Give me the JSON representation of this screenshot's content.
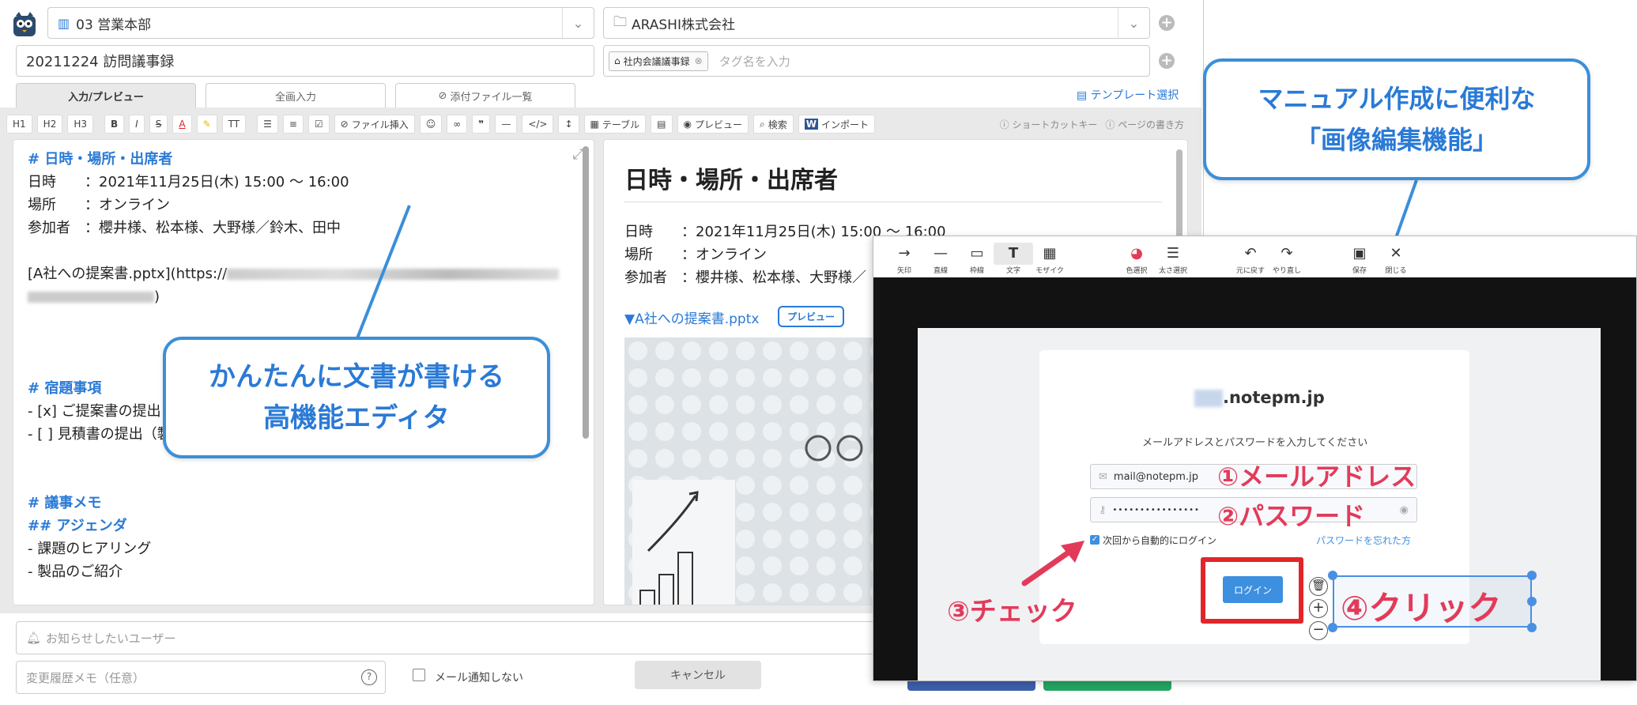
{
  "header": {
    "department": "03 営業本部",
    "folder": "ARASHI株式会社",
    "title": "20211224 訪問議事録",
    "tag": "社内会議議事録",
    "tag_placeholder": "タグ名を入力",
    "template_link": "テンプレート選択"
  },
  "tabs": [
    "入力/プレビュー",
    "全画入力",
    "添付ファイル一覧"
  ],
  "toolbar": {
    "h1": "H1",
    "h2": "H2",
    "h3": "H3",
    "bold": "B",
    "italic": "I",
    "strike": "S",
    "color": "A",
    "size": "TT",
    "attach": "ファイル挿入",
    "table": "テーブル",
    "preview": "プレビュー",
    "search": "検索",
    "import": "インポート",
    "shortcut": "ショートカットキー",
    "howto": "ページの書き方"
  },
  "editor": {
    "h_meeting": "# 日時・場所・出席者",
    "date_line": "日時　　：2021年11月25日(木)  15:00 〜 16:00",
    "place_line": "場所　　：オンライン",
    "attendees_line": "参加者　：櫻井様、松本様、大野様／鈴木、田中",
    "link_line": "[A社への提案書.pptx](https://",
    "h_homework": "# 宿題事項",
    "todo1": "- [x] ご提案書の提出",
    "todo2": "- [ ] 見積書の提出（製",
    "h_memo": "# 議事メモ",
    "h_agenda": "## アジェンダ",
    "agenda1": "- 課題のヒアリング",
    "agenda2": "- 製品のご紹介"
  },
  "preview": {
    "heading": "日時・場所・出席者",
    "date_line": "日時　　：2021年11月25日(木) 15:00 〜 16:00",
    "place_line": "場所　　：オンライン",
    "attendees_line": "参加者　：櫻井様、松本様、大野様／",
    "attachment": "▼A社への提案書.pptx",
    "preview_btn": "プレビュー"
  },
  "footer": {
    "notify_placeholder": "お知らせしたいユーザー",
    "memo_placeholder": "変更履歴メモ（任意）",
    "no_mail": "メール通知しない",
    "cancel": "キャンセル"
  },
  "callouts": {
    "editor_line1": "かんたんに文書が書ける",
    "editor_line2": "高機能エディタ",
    "image_line1": "マニュアル作成に便利な",
    "image_line2": "「画像編集機能」"
  },
  "image_editor": {
    "tools": [
      "矢印",
      "直線",
      "枠線",
      "文字",
      "モザイク",
      "色選択",
      "太さ選択",
      "元に戻す",
      "やり直し",
      "保存",
      "閉じる"
    ],
    "domain": ".notepm.jp",
    "instruction": "メールアドレスとパスワードを入力してください",
    "email_value": "mail@notepm.jp",
    "password_value": "••••••••••••••••",
    "remember": "次回から自動的にログイン",
    "forgot": "パスワードを忘れた方",
    "login_btn": "ログイン",
    "label_email": "①メールアドレス",
    "label_password": "②パスワード",
    "label_check": "③チェック",
    "label_click": "④クリック"
  },
  "colors": {
    "accent": "#2a7ad6",
    "red": "#e23b5a",
    "login_blue": "#3d8fe0"
  }
}
